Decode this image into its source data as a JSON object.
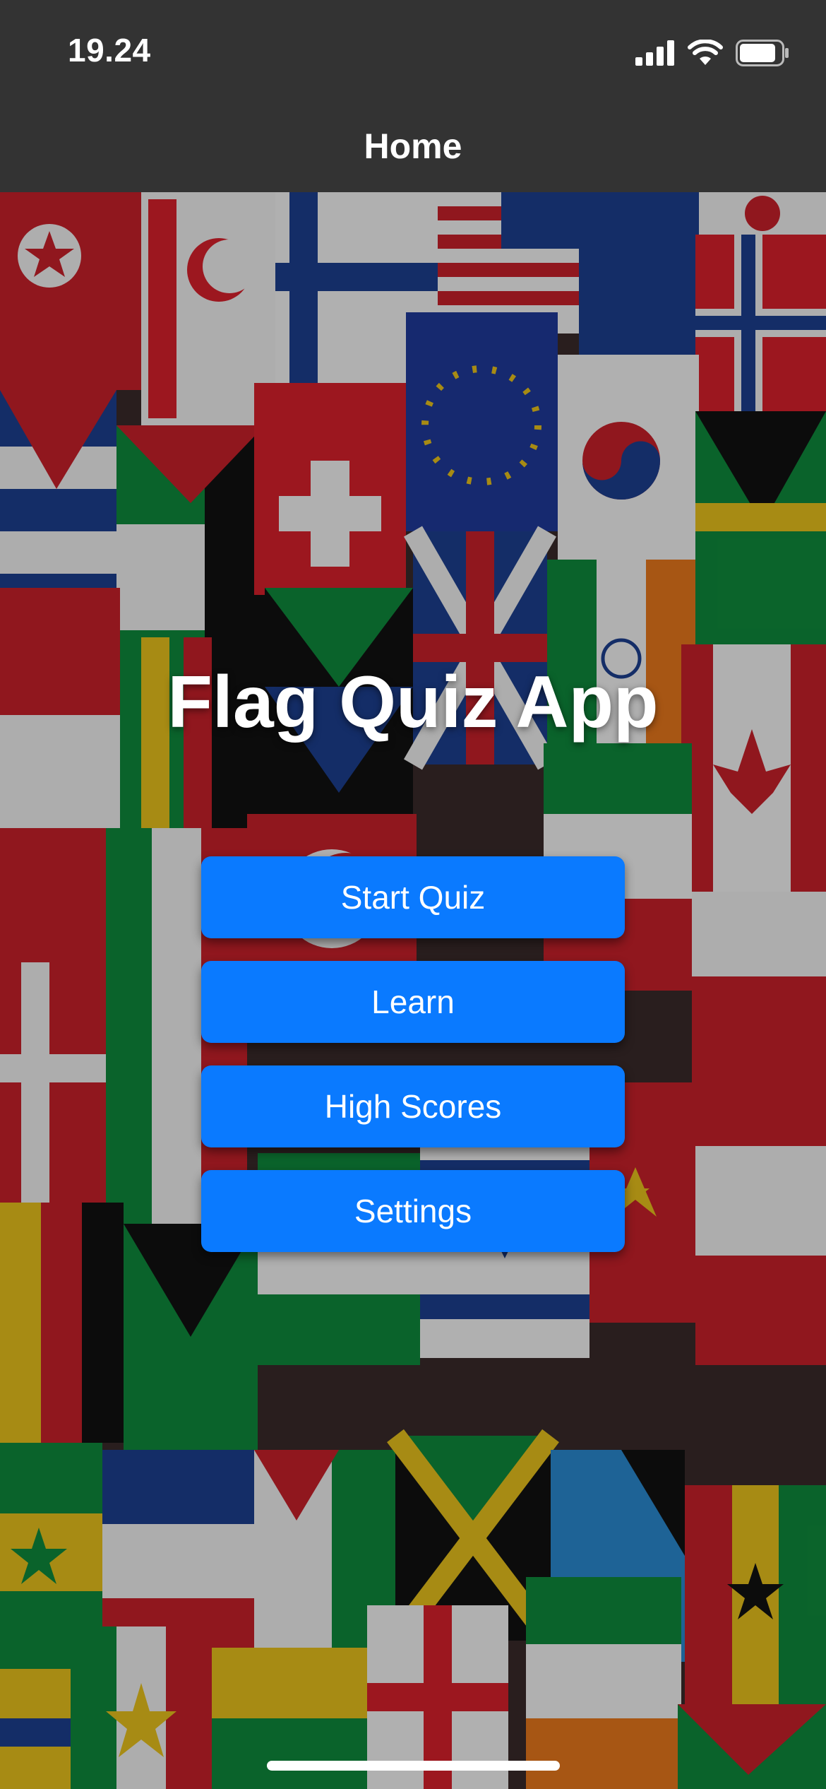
{
  "status_bar": {
    "time": "19.24",
    "signal_icon": "cellular-signal-icon",
    "wifi_icon": "wifi-icon",
    "battery_icon": "battery-icon"
  },
  "nav_bar": {
    "title": "Home"
  },
  "background": {
    "image": "world-flags-collage"
  },
  "main": {
    "title": "Flag Quiz App",
    "buttons": [
      {
        "label": "Start Quiz"
      },
      {
        "label": "Learn"
      },
      {
        "label": "High Scores"
      },
      {
        "label": "Settings"
      }
    ]
  },
  "colors": {
    "button": "#0a7aff",
    "bar": "#333333"
  }
}
